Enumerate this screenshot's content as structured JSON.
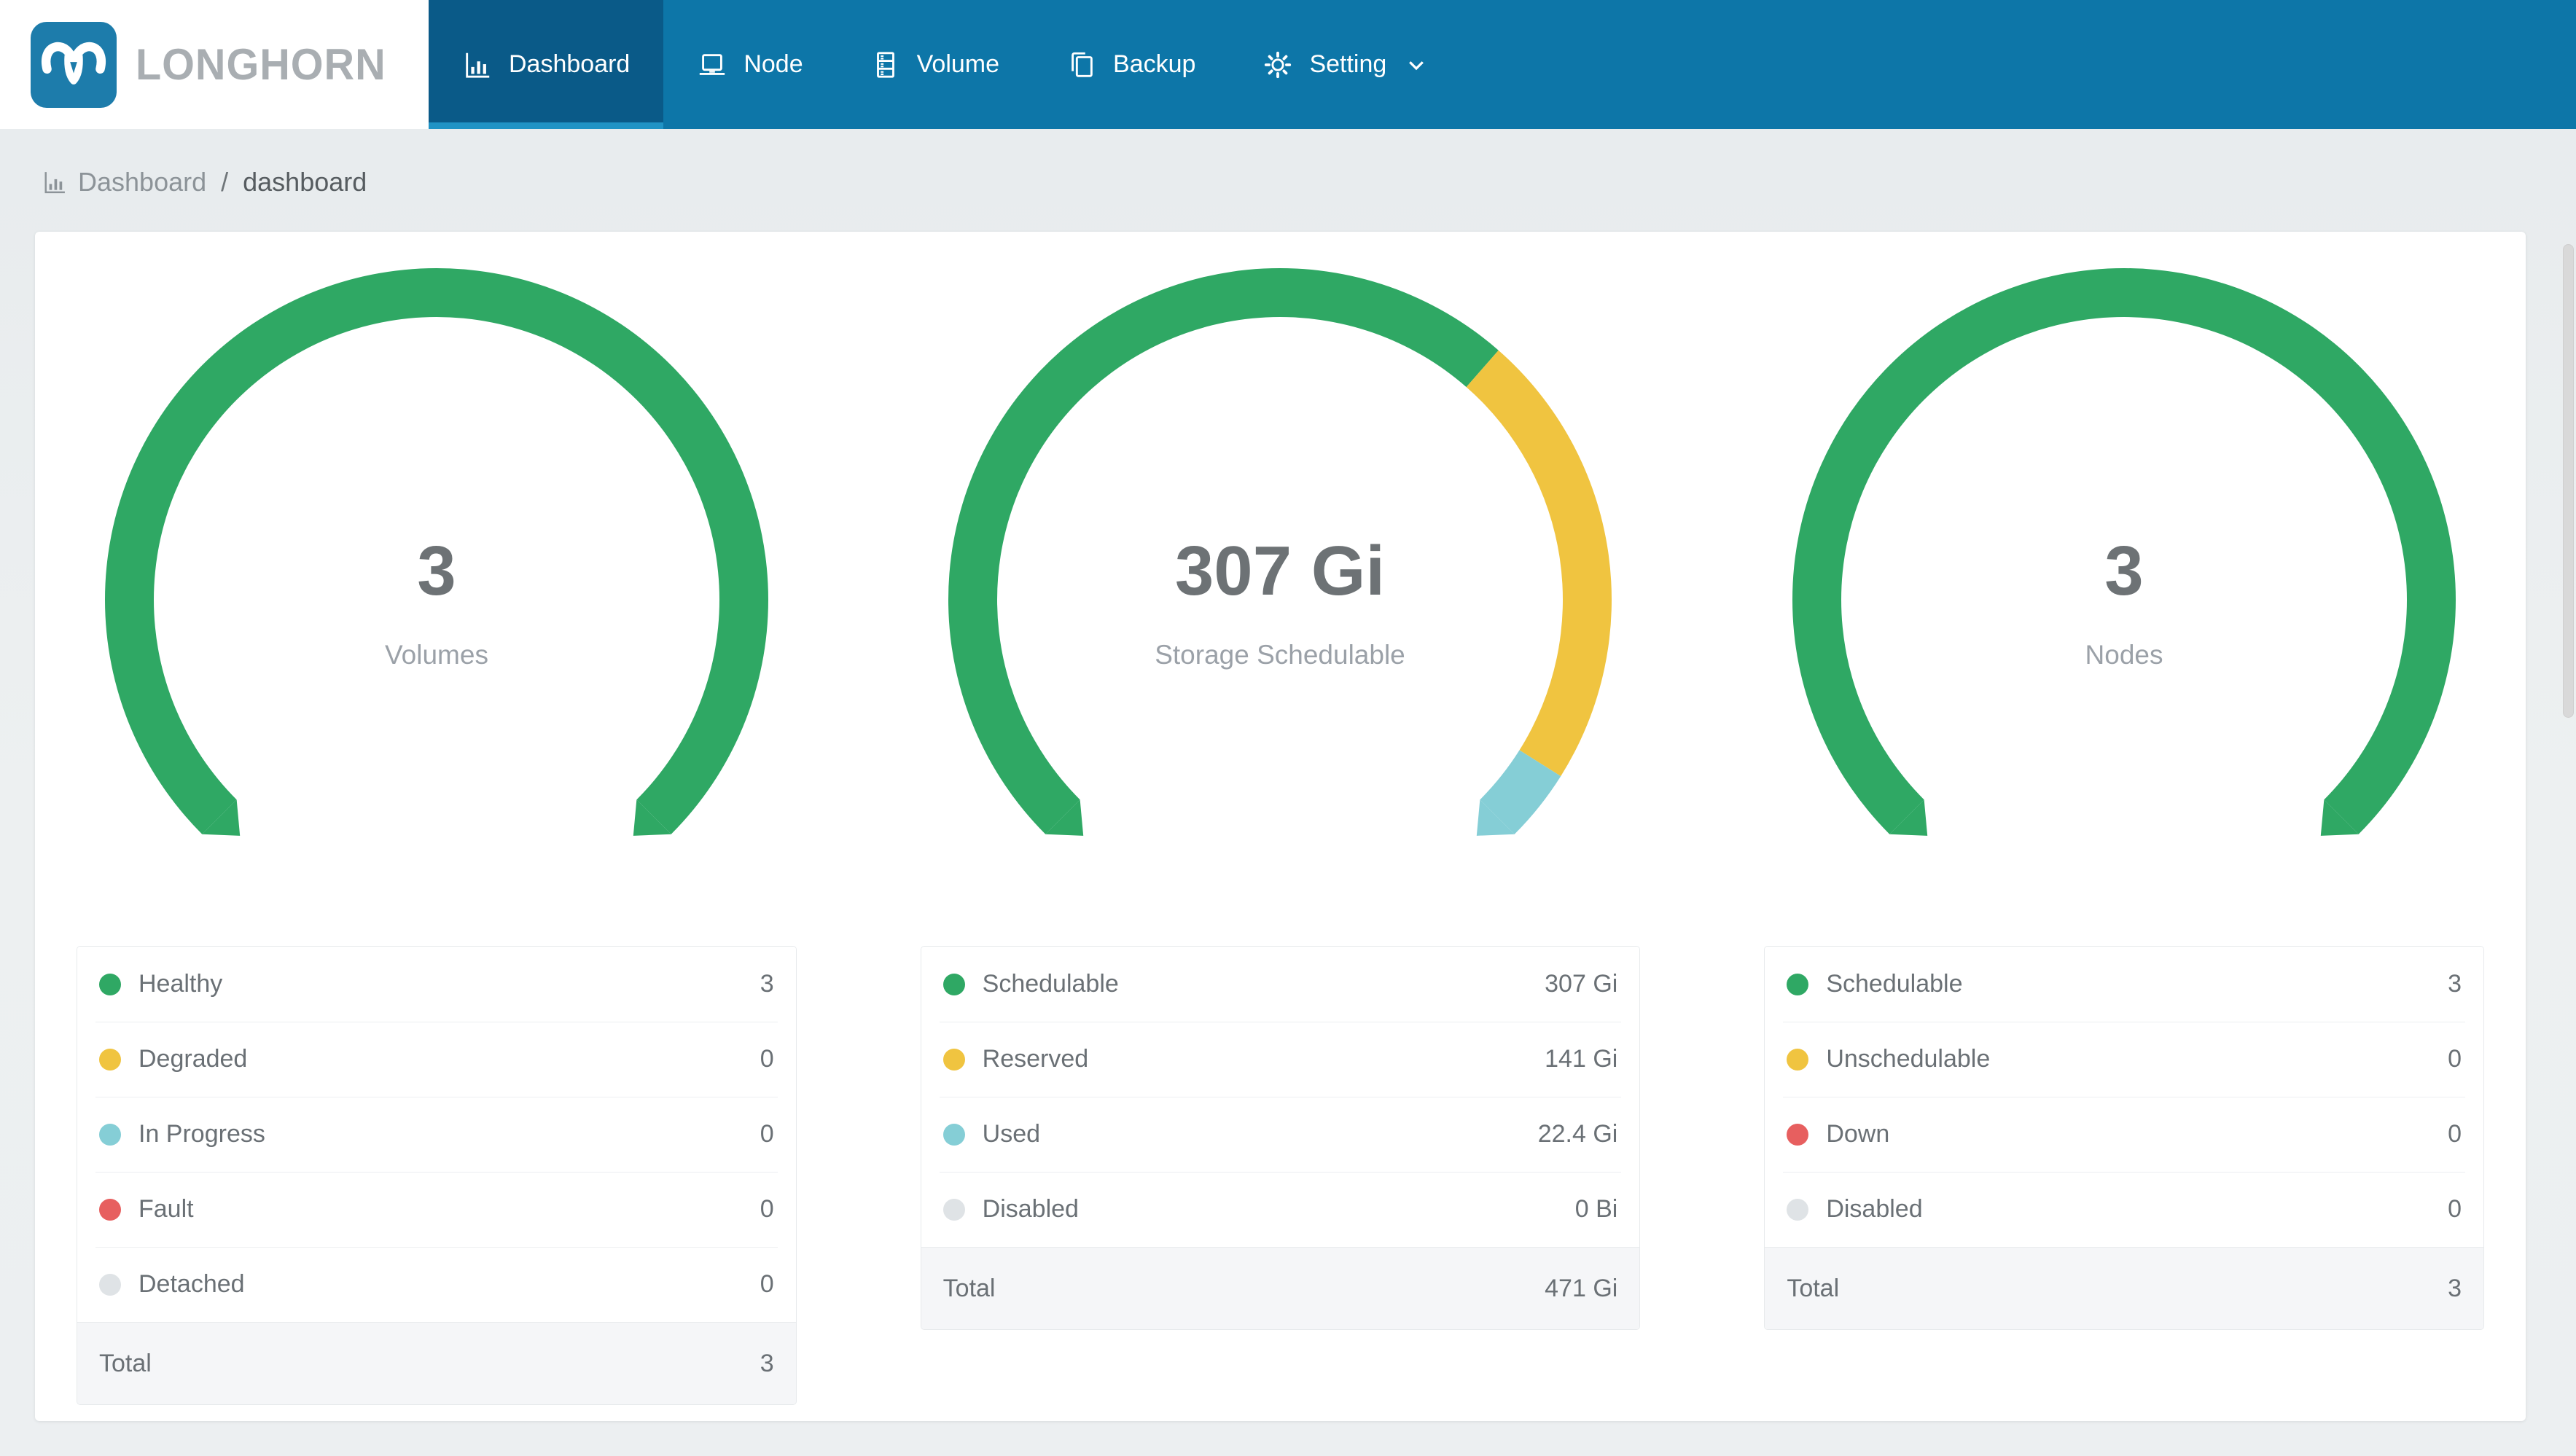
{
  "brand": {
    "name": "LONGHORN"
  },
  "nav": {
    "items": [
      {
        "label": "Dashboard",
        "icon": "bar-chart-icon",
        "active": true
      },
      {
        "label": "Node",
        "icon": "laptop-icon",
        "active": false
      },
      {
        "label": "Volume",
        "icon": "server-icon",
        "active": false
      },
      {
        "label": "Backup",
        "icon": "copy-icon",
        "active": false
      },
      {
        "label": "Setting",
        "icon": "gear-icon",
        "active": false,
        "has_dropdown": true
      }
    ]
  },
  "breadcrumb": {
    "section": "Dashboard",
    "separator": "/",
    "page": "dashboard"
  },
  "colors": {
    "nav_bg": "#0d76a8",
    "nav_active_bg": "#0a5a88",
    "nav_active_underline": "#2093c5",
    "logo_blue": "#1d7cab",
    "green": "#2fa864",
    "yellow": "#f0c440",
    "teal": "#85ced6",
    "red": "#e75f5f",
    "gray": "#dfe3e6"
  },
  "chart_data": [
    {
      "type": "gauge-donut",
      "center_value": "3",
      "center_label": "Volumes",
      "start_angle": 135,
      "sweep": 270,
      "segments": [
        {
          "label": "Healthy",
          "value": 3,
          "display": "3",
          "color": "green"
        },
        {
          "label": "Degraded",
          "value": 0,
          "display": "0",
          "color": "yellow"
        },
        {
          "label": "In Progress",
          "value": 0,
          "display": "0",
          "color": "teal"
        },
        {
          "label": "Fault",
          "value": 0,
          "display": "0",
          "color": "red"
        },
        {
          "label": "Detached",
          "value": 0,
          "display": "0",
          "color": "gray"
        }
      ],
      "total_label": "Total",
      "total_display": "3"
    },
    {
      "type": "gauge-donut",
      "center_value": "307 Gi",
      "center_label": "Storage Schedulable",
      "start_angle": 135,
      "sweep": 270,
      "segments": [
        {
          "label": "Schedulable",
          "value": 307,
          "display": "307 Gi",
          "color": "green"
        },
        {
          "label": "Reserved",
          "value": 141,
          "display": "141 Gi",
          "color": "yellow"
        },
        {
          "label": "Used",
          "value": 22.4,
          "display": "22.4 Gi",
          "color": "teal"
        },
        {
          "label": "Disabled",
          "value": 0,
          "display": "0 Bi",
          "color": "gray"
        }
      ],
      "total_label": "Total",
      "total_display": "471 Gi"
    },
    {
      "type": "gauge-donut",
      "center_value": "3",
      "center_label": "Nodes",
      "start_angle": 135,
      "sweep": 270,
      "segments": [
        {
          "label": "Schedulable",
          "value": 3,
          "display": "3",
          "color": "green"
        },
        {
          "label": "Unschedulable",
          "value": 0,
          "display": "0",
          "color": "yellow"
        },
        {
          "label": "Down",
          "value": 0,
          "display": "0",
          "color": "red"
        },
        {
          "label": "Disabled",
          "value": 0,
          "display": "0",
          "color": "gray"
        }
      ],
      "total_label": "Total",
      "total_display": "3"
    }
  ]
}
